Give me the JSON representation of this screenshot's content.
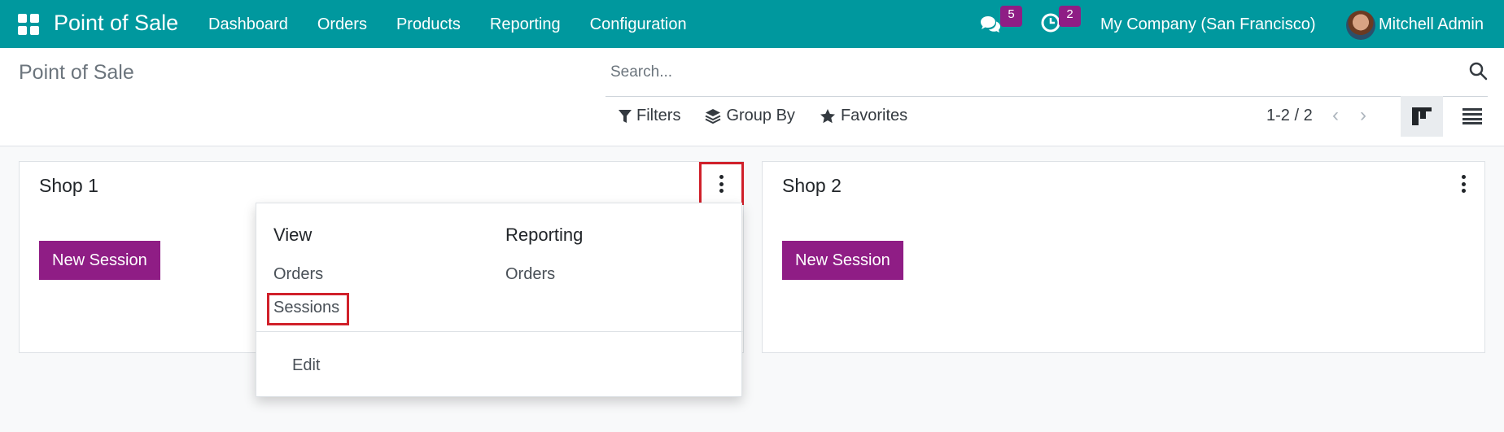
{
  "navbar": {
    "app_name": "Point of Sale",
    "menu": [
      "Dashboard",
      "Orders",
      "Products",
      "Reporting",
      "Configuration"
    ],
    "messages_count": "5",
    "activities_count": "2",
    "company": "My Company (San Francisco)",
    "user": "Mitchell Admin",
    "accent_color": "#00989e",
    "badge_color": "#8f1d85"
  },
  "control_panel": {
    "title": "Point of Sale",
    "search_placeholder": "Search...",
    "filters_label": "Filters",
    "group_by_label": "Group By",
    "favorites_label": "Favorites",
    "pager": "1-2 / 2"
  },
  "cards": [
    {
      "title": "Shop 1",
      "button": "New Session"
    },
    {
      "title": "Shop 2",
      "button": "New Session"
    }
  ],
  "dropdown": {
    "view_heading": "View",
    "view_items": [
      "Orders",
      "Sessions"
    ],
    "reporting_heading": "Reporting",
    "reporting_items": [
      "Orders"
    ],
    "edit_label": "Edit"
  },
  "icons": [
    "apps-icon",
    "chat-icon",
    "clock-icon",
    "search-icon",
    "filter-icon",
    "layers-icon",
    "star-icon",
    "chevron-left-icon",
    "chevron-right-icon",
    "kanban-view-icon",
    "list-view-icon",
    "kebab-icon"
  ],
  "highlight_color": "#d0202a",
  "button_color": "#8f1d85"
}
